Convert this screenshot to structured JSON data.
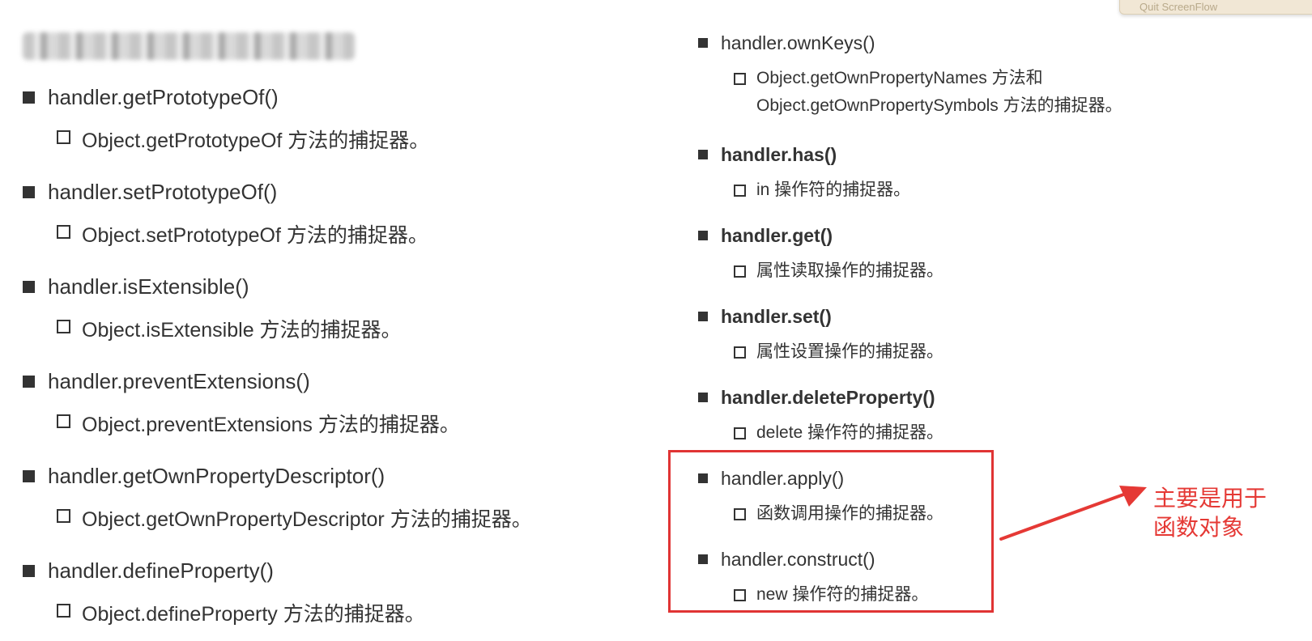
{
  "overlay": {
    "quit_label": "Quit ScreenFlow"
  },
  "left_items": [
    {
      "name": "handler.getPrototypeOf()",
      "desc": "Object.getPrototypeOf 方法的捕捉器。"
    },
    {
      "name": "handler.setPrototypeOf()",
      "desc": "Object.setPrototypeOf 方法的捕捉器。"
    },
    {
      "name": "handler.isExtensible()",
      "desc": "Object.isExtensible 方法的捕捉器。"
    },
    {
      "name": "handler.preventExtensions()",
      "desc": "Object.preventExtensions 方法的捕捉器。"
    },
    {
      "name": "handler.getOwnPropertyDescriptor()",
      "desc": "Object.getOwnPropertyDescriptor 方法的捕捉器。"
    },
    {
      "name": "handler.defineProperty()",
      "desc": "Object.defineProperty 方法的捕捉器。"
    }
  ],
  "right_items": [
    {
      "name": "handler.ownKeys()",
      "desc_line1": "Object.getOwnPropertyNames 方法和",
      "desc_line2": "Object.getOwnPropertySymbols 方法的捕捉器。"
    },
    {
      "name": "handler.has()",
      "desc": "in 操作符的捕捉器。"
    },
    {
      "name": "handler.get()",
      "desc": "属性读取操作的捕捉器。"
    },
    {
      "name": "handler.set()",
      "desc": "属性设置操作的捕捉器。"
    },
    {
      "name": "handler.deleteProperty()",
      "desc": "delete 操作符的捕捉器。"
    },
    {
      "name": "handler.apply()",
      "desc": "函数调用操作的捕捉器。"
    },
    {
      "name": "handler.construct()",
      "desc": "new 操作符的捕捉器。"
    }
  ],
  "annotation": {
    "line1": "主要是用于",
    "line2": "函数对象"
  },
  "colors": {
    "annotation": "#e53935",
    "bullet": "#333333"
  }
}
